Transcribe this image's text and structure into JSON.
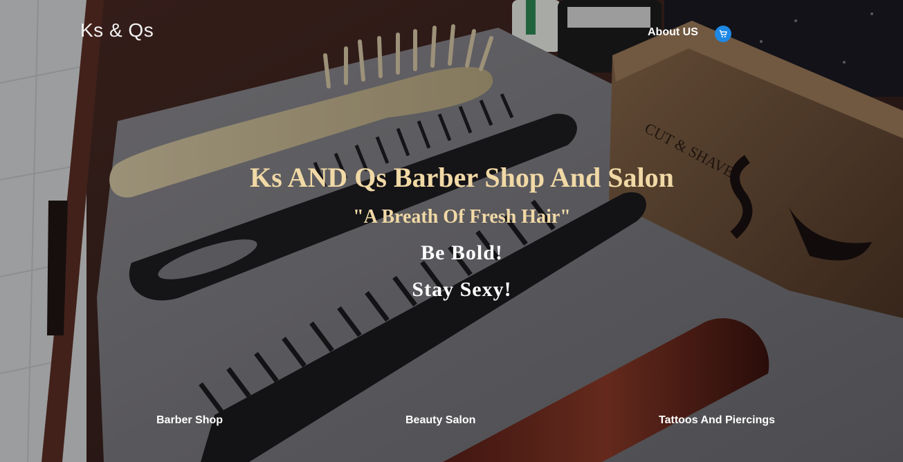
{
  "header": {
    "brand": "Ks & Qs",
    "nav_about": "About US",
    "cart_icon": "shopping-cart-icon"
  },
  "hero": {
    "title": "Ks AND Qs Barber Shop And Salon",
    "tagline": "\"A Breath Of Fresh Hair\"",
    "line1": "Be Bold!",
    "line2": "Stay Sexy!"
  },
  "services": {
    "barber": "Barber Shop",
    "beauty": "Beauty Salon",
    "tattoo": "Tattoos And Piercings"
  },
  "colors": {
    "accent_gold": "#f1d9a6",
    "cart_blue": "#1e88e5"
  }
}
